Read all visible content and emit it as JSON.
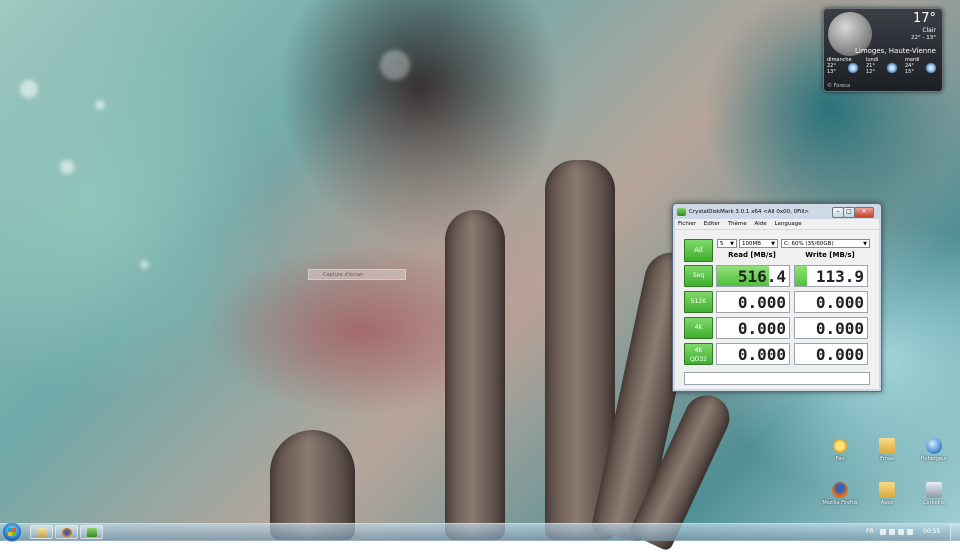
{
  "weather": {
    "temperature": "17°",
    "condition": "Clair",
    "range": "22° - 13°",
    "city": "Limoges, Haute-Vienne",
    "forecast": [
      {
        "day": "dimanche",
        "high": "22°",
        "low": "13°"
      },
      {
        "day": "lundi",
        "high": "21°",
        "low": "12°"
      },
      {
        "day": "mardi",
        "high": "24°",
        "low": "15°"
      }
    ],
    "source": "© Foreca"
  },
  "desktop": {
    "ghost_label": "Capture d'écran"
  },
  "crystaldiskmark": {
    "title": "CrystalDiskMark 3.0.1 x64 <All 0x00, 0Fill>",
    "menu": [
      "Fichier",
      "Editer",
      "Thème",
      "Aide",
      "Language"
    ],
    "all_label": "All",
    "count": "5",
    "size": "100MB",
    "drive": "C: 60% (35/60GB)",
    "read_header": "Read [MB/s]",
    "write_header": "Write [MB/s]",
    "rows": [
      {
        "label": "Seq",
        "label2": "",
        "read": "516.4",
        "write": "113.9",
        "read_level": 0.72,
        "write_level": 0.16
      },
      {
        "label": "512K",
        "label2": "",
        "read": "0.000",
        "write": "0.000",
        "read_level": 0,
        "write_level": 0
      },
      {
        "label": "4K",
        "label2": "",
        "read": "0.000",
        "write": "0.000",
        "read_level": 0,
        "write_level": 0
      },
      {
        "label": "4K",
        "label2": "QD32",
        "read": "0.000",
        "write": "0.000",
        "read_level": 0,
        "write_level": 0
      }
    ],
    "comment": ""
  },
  "icons": [
    {
      "label": "Fav",
      "icon": "star-icon"
    },
    {
      "label": "Fmax",
      "icon": "folder-icon"
    },
    {
      "label": "Hébergeur",
      "icon": "globe-icon"
    },
    {
      "label": "Mozilla Firefox",
      "icon": "firefox-icon"
    },
    {
      "label": "Apps",
      "icon": "folder-icon"
    },
    {
      "label": "Corbeille",
      "icon": "recycle-bin-icon"
    }
  ],
  "taskbar": {
    "language": "FR",
    "clock": "00:55"
  },
  "colors": {
    "accent_green": "#4ec13a",
    "window_frame": "#cfd9e6"
  }
}
